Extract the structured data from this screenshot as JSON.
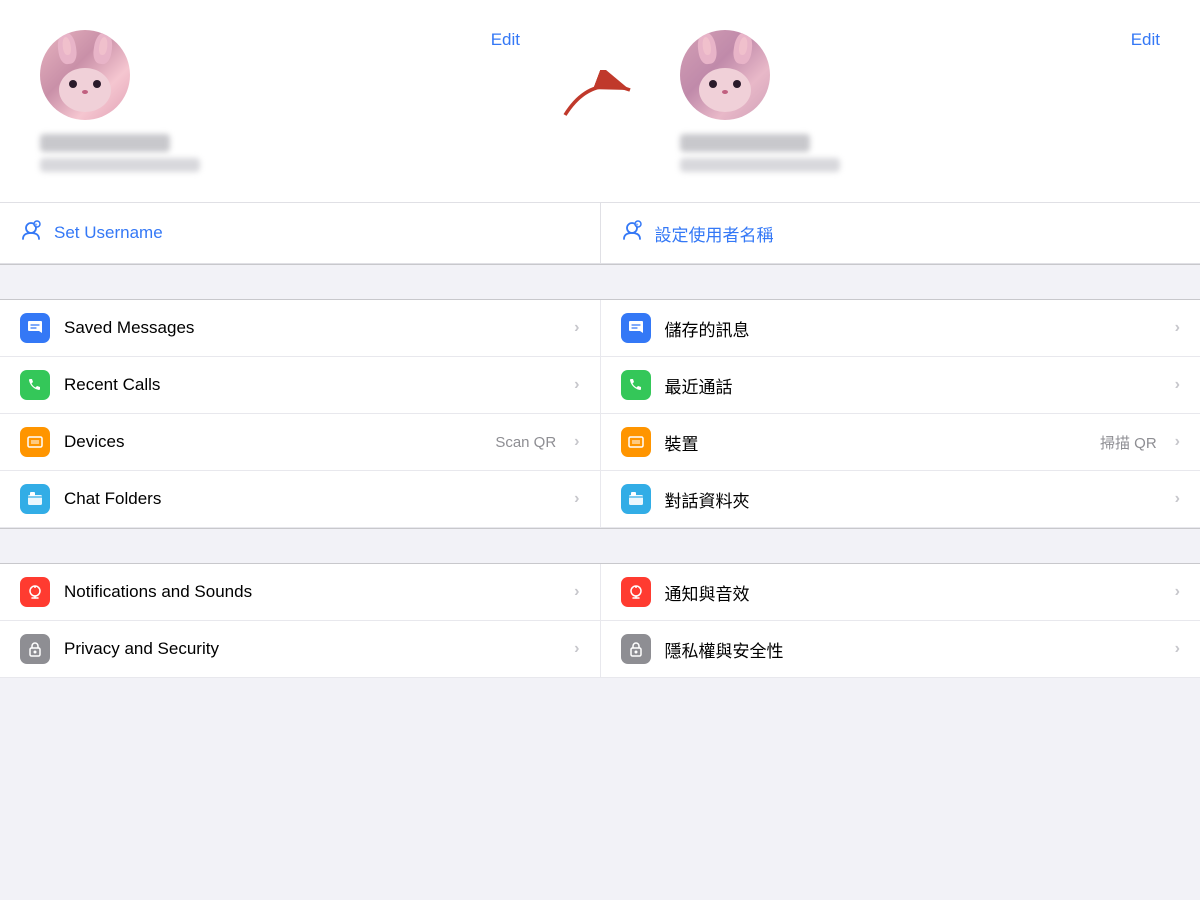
{
  "header": {
    "edit_label": "Edit"
  },
  "profiles": {
    "left": {
      "name_blur": true,
      "username_blur": true
    },
    "right": {
      "name_blur": true,
      "username_blur": true
    }
  },
  "username_section": {
    "left": {
      "icon": "⊕",
      "label": "Set Username"
    },
    "right": {
      "icon": "⊕",
      "label": "設定使用者名稱"
    }
  },
  "menu_items": [
    {
      "left_icon_class": "icon-blue",
      "left_icon": "🔖",
      "left_label": "Saved Messages",
      "left_sub": "",
      "right_icon_class": "icon-blue",
      "right_icon": "🔖",
      "right_label": "儲存的訊息",
      "right_sub": ""
    },
    {
      "left_icon_class": "icon-green",
      "left_icon": "📞",
      "left_label": "Recent Calls",
      "left_sub": "",
      "right_icon_class": "icon-green",
      "right_icon": "📞",
      "right_label": "最近通話",
      "right_sub": ""
    },
    {
      "left_icon_class": "icon-orange",
      "left_icon": "💻",
      "left_label": "Devices",
      "left_sub": "Scan QR",
      "right_icon_class": "icon-orange",
      "right_icon": "💻",
      "right_label": "裝置",
      "right_sub": "掃描 QR"
    },
    {
      "left_icon_class": "icon-cyan",
      "left_icon": "📁",
      "left_label": "Chat Folders",
      "left_sub": "",
      "right_icon_class": "icon-cyan",
      "right_icon": "📁",
      "right_label": "對話資料夾",
      "right_sub": ""
    }
  ],
  "menu_items2": [
    {
      "left_icon_class": "icon-red",
      "left_icon": "🔔",
      "left_label": "Notifications and Sounds",
      "left_sub": "",
      "right_icon_class": "icon-red",
      "right_icon": "🔔",
      "right_label": "通知與音效",
      "right_sub": ""
    },
    {
      "left_icon_class": "icon-gray",
      "left_icon": "🔒",
      "left_label": "Privacy and Security",
      "left_sub": "",
      "right_icon_class": "icon-gray",
      "right_icon": "🔒",
      "right_label": "隱私權與安全性",
      "right_sub": ""
    }
  ],
  "chevron": "›"
}
